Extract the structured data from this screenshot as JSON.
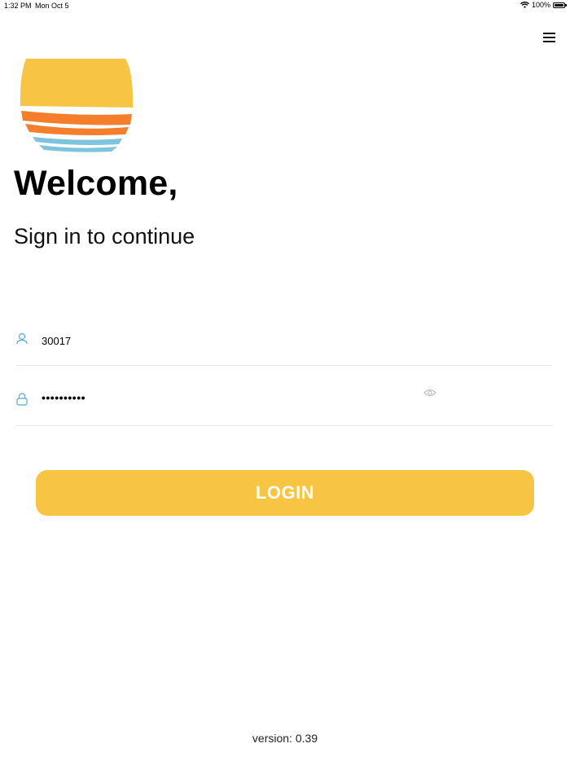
{
  "status_bar": {
    "time": "1:32 PM",
    "date": "Mon Oct 5",
    "battery": "100%",
    "battery_level": 1.0
  },
  "icons": {
    "menu": "hamburger-menu-icon",
    "logo": "sunset-logo",
    "username": "user-icon",
    "password": "lock-icon",
    "reveal": "eye-icon"
  },
  "colors": {
    "accent": "#f7c443",
    "sun_yellow": "#f7c443",
    "sun_orange": "#f47e2c",
    "water_blue": "#7ec4df",
    "field_icon": "#5aa8d6"
  },
  "header": {
    "title": "Welcome,",
    "subtitle": "Sign in to continue"
  },
  "form": {
    "username_value": "30017",
    "password_display": "••••••••••",
    "login_label": "LOGIN"
  },
  "footer": {
    "version": "version: 0.39"
  }
}
